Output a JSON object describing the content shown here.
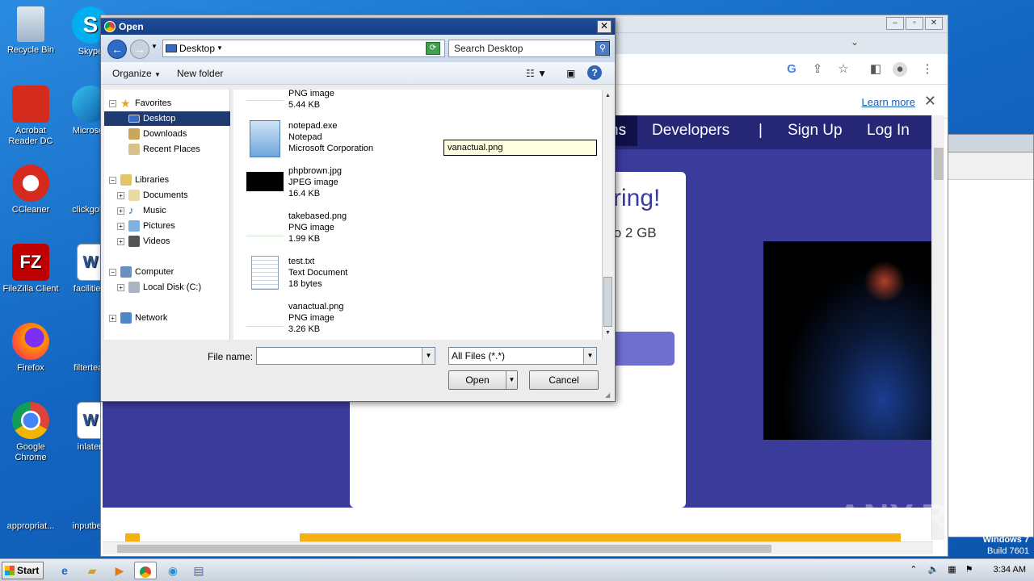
{
  "desktop": {
    "icons": [
      {
        "label": "Recycle Bin"
      },
      {
        "label": "Skype"
      },
      {
        "label": "Acrobat Reader DC"
      },
      {
        "label": "Microsoft"
      },
      {
        "label": "CCleaner"
      },
      {
        "label": "clickgold."
      },
      {
        "label": "FileZilla Client"
      },
      {
        "label": "facilitiesf"
      },
      {
        "label": "Firefox"
      },
      {
        "label": "filterteac"
      },
      {
        "label": "Google Chrome"
      },
      {
        "label": "inlater."
      },
      {
        "label": "appropriat..."
      },
      {
        "label": "inputbetti"
      }
    ]
  },
  "browser": {
    "learn_more": "Learn more",
    "nav": {
      "partial": "ns",
      "developers": "Developers",
      "sep": "|",
      "signup": "Sign Up",
      "login": "Log In"
    },
    "headline": "ring!",
    "subline": "to 2 GB"
  },
  "dialog": {
    "title": "Open",
    "path": "Desktop",
    "search_placeholder": "Search Desktop",
    "organize": "Organize",
    "new_folder": "New folder",
    "nav": {
      "favorites": "Favorites",
      "desktop": "Desktop",
      "downloads": "Downloads",
      "recent": "Recent Places",
      "libraries": "Libraries",
      "documents": "Documents",
      "music": "Music",
      "pictures": "Pictures",
      "videos": "Videos",
      "computer": "Computer",
      "local_disk": "Local Disk (C:)",
      "network": "Network"
    },
    "files": [
      {
        "name": "",
        "type": "PNG image",
        "size": "5.44 KB"
      },
      {
        "name": "notepad.exe",
        "type": "Notepad",
        "size": "Microsoft Corporation"
      },
      {
        "name": "phpbrown.jpg",
        "type": "JPEG image",
        "size": "16.4 KB"
      },
      {
        "name": "takebased.png",
        "type": "PNG image",
        "size": "1.99 KB"
      },
      {
        "name": "test.txt",
        "type": "Text Document",
        "size": "18 bytes"
      },
      {
        "name": "vanactual.png",
        "type": "PNG image",
        "size": "3.26 KB"
      }
    ],
    "rename_value": "vanactual.png",
    "file_name_label": "File name:",
    "file_name_value": "",
    "file_type": "All Files (*.*)",
    "open_label": "Open",
    "cancel_label": "Cancel"
  },
  "taskbar": {
    "start": "Start",
    "time": "3:34 AM"
  },
  "watermark": {
    "win": "Windows 7",
    "build": "Build 7601",
    "anyrun": "ANY.RUN"
  }
}
